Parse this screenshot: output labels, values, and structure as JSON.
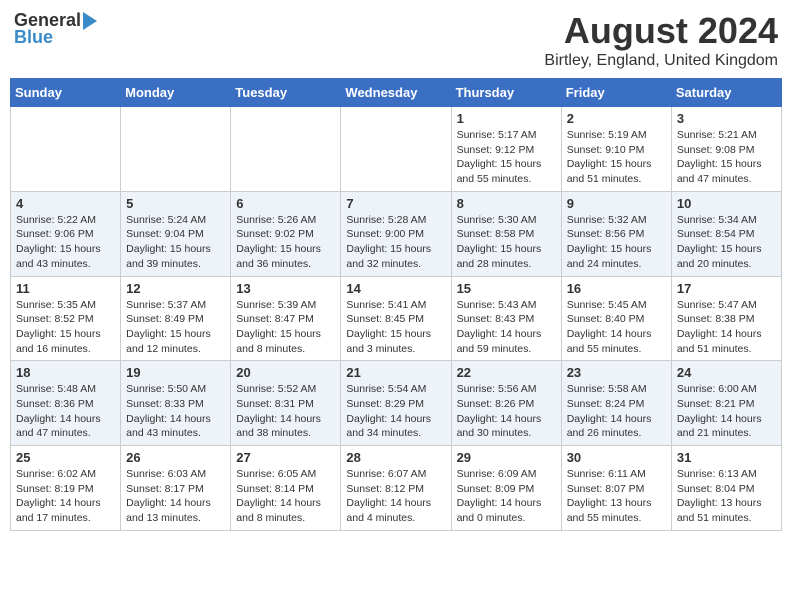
{
  "logo": {
    "general": "General",
    "blue": "Blue"
  },
  "title": "August 2024",
  "subtitle": "Birtley, England, United Kingdom",
  "days_of_week": [
    "Sunday",
    "Monday",
    "Tuesday",
    "Wednesday",
    "Thursday",
    "Friday",
    "Saturday"
  ],
  "weeks": [
    [
      {
        "day": "",
        "info": ""
      },
      {
        "day": "",
        "info": ""
      },
      {
        "day": "",
        "info": ""
      },
      {
        "day": "",
        "info": ""
      },
      {
        "day": "1",
        "info": "Sunrise: 5:17 AM\nSunset: 9:12 PM\nDaylight: 15 hours\nand 55 minutes."
      },
      {
        "day": "2",
        "info": "Sunrise: 5:19 AM\nSunset: 9:10 PM\nDaylight: 15 hours\nand 51 minutes."
      },
      {
        "day": "3",
        "info": "Sunrise: 5:21 AM\nSunset: 9:08 PM\nDaylight: 15 hours\nand 47 minutes."
      }
    ],
    [
      {
        "day": "4",
        "info": "Sunrise: 5:22 AM\nSunset: 9:06 PM\nDaylight: 15 hours\nand 43 minutes."
      },
      {
        "day": "5",
        "info": "Sunrise: 5:24 AM\nSunset: 9:04 PM\nDaylight: 15 hours\nand 39 minutes."
      },
      {
        "day": "6",
        "info": "Sunrise: 5:26 AM\nSunset: 9:02 PM\nDaylight: 15 hours\nand 36 minutes."
      },
      {
        "day": "7",
        "info": "Sunrise: 5:28 AM\nSunset: 9:00 PM\nDaylight: 15 hours\nand 32 minutes."
      },
      {
        "day": "8",
        "info": "Sunrise: 5:30 AM\nSunset: 8:58 PM\nDaylight: 15 hours\nand 28 minutes."
      },
      {
        "day": "9",
        "info": "Sunrise: 5:32 AM\nSunset: 8:56 PM\nDaylight: 15 hours\nand 24 minutes."
      },
      {
        "day": "10",
        "info": "Sunrise: 5:34 AM\nSunset: 8:54 PM\nDaylight: 15 hours\nand 20 minutes."
      }
    ],
    [
      {
        "day": "11",
        "info": "Sunrise: 5:35 AM\nSunset: 8:52 PM\nDaylight: 15 hours\nand 16 minutes."
      },
      {
        "day": "12",
        "info": "Sunrise: 5:37 AM\nSunset: 8:49 PM\nDaylight: 15 hours\nand 12 minutes."
      },
      {
        "day": "13",
        "info": "Sunrise: 5:39 AM\nSunset: 8:47 PM\nDaylight: 15 hours\nand 8 minutes."
      },
      {
        "day": "14",
        "info": "Sunrise: 5:41 AM\nSunset: 8:45 PM\nDaylight: 15 hours\nand 3 minutes."
      },
      {
        "day": "15",
        "info": "Sunrise: 5:43 AM\nSunset: 8:43 PM\nDaylight: 14 hours\nand 59 minutes."
      },
      {
        "day": "16",
        "info": "Sunrise: 5:45 AM\nSunset: 8:40 PM\nDaylight: 14 hours\nand 55 minutes."
      },
      {
        "day": "17",
        "info": "Sunrise: 5:47 AM\nSunset: 8:38 PM\nDaylight: 14 hours\nand 51 minutes."
      }
    ],
    [
      {
        "day": "18",
        "info": "Sunrise: 5:48 AM\nSunset: 8:36 PM\nDaylight: 14 hours\nand 47 minutes."
      },
      {
        "day": "19",
        "info": "Sunrise: 5:50 AM\nSunset: 8:33 PM\nDaylight: 14 hours\nand 43 minutes."
      },
      {
        "day": "20",
        "info": "Sunrise: 5:52 AM\nSunset: 8:31 PM\nDaylight: 14 hours\nand 38 minutes."
      },
      {
        "day": "21",
        "info": "Sunrise: 5:54 AM\nSunset: 8:29 PM\nDaylight: 14 hours\nand 34 minutes."
      },
      {
        "day": "22",
        "info": "Sunrise: 5:56 AM\nSunset: 8:26 PM\nDaylight: 14 hours\nand 30 minutes."
      },
      {
        "day": "23",
        "info": "Sunrise: 5:58 AM\nSunset: 8:24 PM\nDaylight: 14 hours\nand 26 minutes."
      },
      {
        "day": "24",
        "info": "Sunrise: 6:00 AM\nSunset: 8:21 PM\nDaylight: 14 hours\nand 21 minutes."
      }
    ],
    [
      {
        "day": "25",
        "info": "Sunrise: 6:02 AM\nSunset: 8:19 PM\nDaylight: 14 hours\nand 17 minutes."
      },
      {
        "day": "26",
        "info": "Sunrise: 6:03 AM\nSunset: 8:17 PM\nDaylight: 14 hours\nand 13 minutes."
      },
      {
        "day": "27",
        "info": "Sunrise: 6:05 AM\nSunset: 8:14 PM\nDaylight: 14 hours\nand 8 minutes."
      },
      {
        "day": "28",
        "info": "Sunrise: 6:07 AM\nSunset: 8:12 PM\nDaylight: 14 hours\nand 4 minutes."
      },
      {
        "day": "29",
        "info": "Sunrise: 6:09 AM\nSunset: 8:09 PM\nDaylight: 14 hours\nand 0 minutes."
      },
      {
        "day": "30",
        "info": "Sunrise: 6:11 AM\nSunset: 8:07 PM\nDaylight: 13 hours\nand 55 minutes."
      },
      {
        "day": "31",
        "info": "Sunrise: 6:13 AM\nSunset: 8:04 PM\nDaylight: 13 hours\nand 51 minutes."
      }
    ]
  ]
}
